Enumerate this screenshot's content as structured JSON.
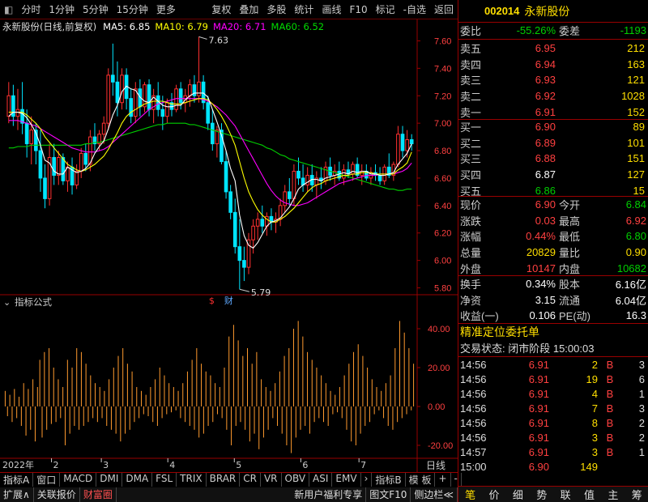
{
  "toolbar": {
    "left": [
      "分时",
      "1分钟",
      "5分钟",
      "15分钟",
      "更多"
    ],
    "right": [
      "复权",
      "叠加",
      "多股",
      "统计",
      "画线",
      "F10",
      "标记",
      "-自选",
      "返回"
    ]
  },
  "chart_title": {
    "name": "永新股份(日线,前复权)",
    "ma5": "MA5: 6.85",
    "ma10": "MA10: 6.79",
    "ma20": "MA20: 6.71",
    "ma60": "MA60: 6.52"
  },
  "colors": {
    "up": "#ff3030",
    "down": "#00e5ff",
    "ma5": "#ffffff",
    "ma10": "#ffff00",
    "ma20": "#ff00ff",
    "ma60": "#00d000",
    "macd": "#ff9a2e",
    "frame": "#990000"
  },
  "chart_data": [
    {
      "type": "candlestick",
      "ylim": [
        5.75,
        7.65
      ],
      "yticks": [
        "7.60",
        "7.40",
        "7.20",
        "7.00",
        "6.80",
        "6.60",
        "6.40",
        "6.20",
        "6.00",
        "5.80"
      ],
      "annotations": {
        "high": "7.63",
        "low": "5.79",
        "markers": [
          "$",
          "财"
        ]
      },
      "x_axis": {
        "year_label": "2022年",
        "months": [
          "2",
          "3",
          "4",
          "5",
          "6",
          "7"
        ]
      },
      "series_labels": [
        "MA5",
        "MA10",
        "MA20",
        "MA60"
      ],
      "ohlc": [
        [
          7.05,
          7.3,
          7.0,
          7.2
        ],
        [
          7.2,
          7.28,
          6.98,
          7.05
        ],
        [
          7.05,
          7.25,
          6.95,
          7.1
        ],
        [
          7.1,
          7.3,
          6.92,
          7.0
        ],
        [
          7.0,
          7.1,
          6.75,
          6.85
        ],
        [
          6.85,
          7.05,
          6.7,
          6.95
        ],
        [
          6.95,
          7.0,
          6.7,
          6.8
        ],
        [
          6.8,
          6.95,
          6.5,
          6.6
        ],
        [
          6.6,
          6.7,
          6.38,
          6.45
        ],
        [
          6.45,
          6.85,
          6.4,
          6.75
        ],
        [
          6.75,
          6.85,
          6.55,
          6.62
        ],
        [
          6.62,
          6.8,
          6.55,
          6.75
        ],
        [
          6.75,
          6.78,
          6.55,
          6.58
        ],
        [
          6.58,
          6.72,
          6.5,
          6.68
        ],
        [
          6.68,
          6.75,
          6.48,
          6.55
        ],
        [
          6.55,
          6.7,
          6.52,
          6.65
        ],
        [
          6.65,
          6.82,
          6.6,
          6.78
        ],
        [
          6.78,
          6.85,
          6.65,
          6.7
        ],
        [
          6.7,
          6.95,
          6.65,
          6.9
        ],
        [
          6.9,
          7.0,
          6.8,
          6.85
        ],
        [
          6.85,
          6.95,
          6.8,
          6.92
        ],
        [
          6.92,
          7.05,
          6.85,
          7.0
        ],
        [
          7.0,
          7.4,
          6.95,
          7.35
        ],
        [
          7.35,
          7.58,
          7.2,
          7.3
        ],
        [
          7.3,
          7.45,
          7.05,
          7.15
        ],
        [
          7.15,
          7.4,
          7.1,
          7.35
        ],
        [
          7.35,
          7.4,
          7.1,
          7.18
        ],
        [
          7.18,
          7.25,
          7.0,
          7.05
        ],
        [
          7.05,
          7.3,
          7.0,
          7.25
        ],
        [
          7.25,
          7.32,
          7.05,
          7.12
        ],
        [
          7.12,
          7.3,
          7.08,
          7.28
        ],
        [
          7.28,
          7.32,
          7.05,
          7.1
        ],
        [
          7.1,
          7.25,
          7.0,
          7.2
        ],
        [
          7.2,
          7.3,
          7.05,
          7.1
        ],
        [
          7.1,
          7.2,
          6.95,
          7.05
        ],
        [
          7.05,
          7.18,
          7.0,
          7.15
        ],
        [
          7.15,
          7.22,
          7.05,
          7.1
        ],
        [
          7.1,
          7.28,
          7.08,
          7.25
        ],
        [
          7.25,
          7.3,
          7.1,
          7.15
        ],
        [
          7.15,
          7.25,
          7.08,
          7.2
        ],
        [
          7.2,
          7.32,
          7.12,
          7.28
        ],
        [
          7.28,
          7.35,
          7.15,
          7.2
        ],
        [
          7.2,
          7.63,
          7.15,
          7.3
        ],
        [
          7.3,
          7.35,
          7.1,
          7.15
        ],
        [
          7.15,
          7.2,
          6.95,
          7.0
        ],
        [
          7.0,
          7.1,
          6.8,
          6.85
        ],
        [
          6.85,
          6.98,
          6.75,
          6.95
        ],
        [
          6.95,
          7.0,
          6.7,
          6.72
        ],
        [
          6.72,
          6.8,
          6.45,
          6.5
        ],
        [
          6.5,
          6.55,
          6.3,
          6.35
        ],
        [
          6.35,
          6.45,
          6.05,
          6.1
        ],
        [
          6.1,
          6.3,
          5.79,
          6.0
        ],
        [
          6.0,
          6.1,
          5.85,
          5.95
        ],
        [
          5.95,
          6.2,
          5.9,
          6.15
        ],
        [
          6.15,
          6.3,
          6.05,
          6.25
        ],
        [
          6.25,
          6.35,
          6.15,
          6.3
        ],
        [
          6.3,
          6.4,
          6.2,
          6.25
        ],
        [
          6.25,
          6.35,
          6.18,
          6.32
        ],
        [
          6.32,
          6.38,
          6.22,
          6.28
        ],
        [
          6.28,
          6.35,
          6.2,
          6.3
        ],
        [
          6.3,
          6.45,
          6.25,
          6.4
        ],
        [
          6.4,
          6.55,
          6.35,
          6.5
        ],
        [
          6.5,
          6.6,
          6.4,
          6.45
        ],
        [
          6.45,
          6.7,
          6.4,
          6.65
        ],
        [
          6.65,
          6.75,
          6.55,
          6.6
        ],
        [
          6.6,
          6.7,
          6.5,
          6.55
        ],
        [
          6.55,
          6.68,
          6.5,
          6.62
        ],
        [
          6.62,
          6.7,
          6.5,
          6.55
        ],
        [
          6.55,
          6.65,
          6.45,
          6.6
        ],
        [
          6.6,
          6.68,
          6.52,
          6.58
        ],
        [
          6.58,
          6.72,
          6.55,
          6.68
        ],
        [
          6.68,
          6.75,
          6.58,
          6.62
        ],
        [
          6.62,
          6.7,
          6.55,
          6.65
        ],
        [
          6.65,
          6.72,
          6.58,
          6.6
        ],
        [
          6.6,
          6.7,
          6.55,
          6.66
        ],
        [
          6.66,
          6.72,
          6.6,
          6.63
        ],
        [
          6.63,
          6.72,
          6.58,
          6.7
        ],
        [
          6.7,
          6.75,
          6.6,
          6.62
        ],
        [
          6.62,
          6.7,
          6.55,
          6.65
        ],
        [
          6.65,
          6.7,
          6.58,
          6.6
        ],
        [
          6.6,
          6.68,
          6.55,
          6.64
        ],
        [
          6.64,
          6.7,
          6.58,
          6.62
        ],
        [
          6.62,
          6.68,
          6.55,
          6.58
        ],
        [
          6.58,
          6.7,
          6.55,
          6.68
        ],
        [
          6.68,
          6.78,
          6.6,
          6.62
        ],
        [
          6.62,
          6.72,
          6.58,
          6.7
        ],
        [
          6.7,
          6.98,
          6.68,
          6.92
        ],
        [
          6.92,
          6.98,
          6.75,
          6.8
        ],
        [
          6.8,
          6.95,
          6.75,
          6.88
        ],
        [
          6.88,
          6.92,
          6.8,
          6.85
        ]
      ],
      "ma5": [
        7.05,
        7.08,
        7.08,
        7.07,
        7.04,
        6.99,
        6.93,
        6.84,
        6.73,
        6.71,
        6.65,
        6.63,
        6.63,
        6.68,
        6.66,
        6.64,
        6.65,
        6.67,
        6.71,
        6.78,
        6.83,
        6.87,
        6.96,
        7.06,
        7.13,
        7.23,
        7.27,
        7.25,
        7.24,
        7.19,
        7.16,
        7.15,
        7.19,
        7.16,
        7.13,
        7.12,
        7.12,
        7.13,
        7.13,
        7.17,
        7.2,
        7.22,
        7.22,
        7.22,
        7.19,
        7.1,
        7.01,
        6.91,
        6.8,
        6.67,
        6.58,
        6.33,
        6.18,
        6.11,
        6.09,
        6.13,
        6.19,
        6.25,
        6.28,
        6.29,
        6.31,
        6.35,
        6.39,
        6.45,
        6.52,
        6.55,
        6.57,
        6.59,
        6.59,
        6.58,
        6.6,
        6.61,
        6.62,
        6.63,
        6.64,
        6.63,
        6.65,
        6.64,
        6.65,
        6.65,
        6.63,
        6.63,
        6.62,
        6.62,
        6.63,
        6.64,
        6.7,
        6.74,
        6.78,
        6.85
      ],
      "ma10": [
        7.08,
        7.08,
        7.08,
        7.08,
        7.06,
        7.03,
        7.0,
        6.96,
        6.9,
        6.86,
        6.82,
        6.78,
        6.74,
        6.7,
        6.68,
        6.66,
        6.65,
        6.66,
        6.68,
        6.7,
        6.73,
        6.76,
        6.81,
        6.87,
        6.93,
        7.0,
        7.05,
        7.08,
        7.1,
        7.12,
        7.14,
        7.15,
        7.16,
        7.16,
        7.16,
        7.15,
        7.14,
        7.14,
        7.14,
        7.15,
        7.16,
        7.17,
        7.18,
        7.18,
        7.17,
        7.14,
        7.1,
        7.05,
        6.99,
        6.92,
        6.84,
        6.72,
        6.6,
        6.5,
        6.43,
        6.37,
        6.33,
        6.3,
        6.28,
        6.28,
        6.3,
        6.32,
        6.35,
        6.38,
        6.42,
        6.46,
        6.5,
        6.53,
        6.55,
        6.56,
        6.58,
        6.59,
        6.6,
        6.61,
        6.62,
        6.62,
        6.63,
        6.63,
        6.64,
        6.64,
        6.64,
        6.63,
        6.63,
        6.63,
        6.63,
        6.63,
        6.66,
        6.68,
        6.71,
        6.79
      ],
      "ma20": [
        7.02,
        7.02,
        7.02,
        7.01,
        7.0,
        6.99,
        6.98,
        6.96,
        6.94,
        6.92,
        6.9,
        6.88,
        6.86,
        6.84,
        6.82,
        6.81,
        6.8,
        6.79,
        6.79,
        6.79,
        6.8,
        6.81,
        6.83,
        6.86,
        6.89,
        6.92,
        6.95,
        6.98,
        7.01,
        7.04,
        7.07,
        7.1,
        7.12,
        7.14,
        7.15,
        7.16,
        7.17,
        7.18,
        7.18,
        7.18,
        7.18,
        7.18,
        7.18,
        7.17,
        7.16,
        7.14,
        7.12,
        7.09,
        7.06,
        7.02,
        6.98,
        6.92,
        6.86,
        6.8,
        6.74,
        6.68,
        6.62,
        6.56,
        6.51,
        6.47,
        6.44,
        6.42,
        6.41,
        6.4,
        6.4,
        6.41,
        6.42,
        6.44,
        6.46,
        6.48,
        6.5,
        6.52,
        6.54,
        6.56,
        6.57,
        6.58,
        6.59,
        6.6,
        6.61,
        6.62,
        6.62,
        6.62,
        6.63,
        6.63,
        6.63,
        6.63,
        6.64,
        6.65,
        6.67,
        6.71
      ],
      "ma60": [
        6.82,
        6.82,
        6.83,
        6.83,
        6.83,
        6.84,
        6.84,
        6.84,
        6.84,
        6.84,
        6.84,
        6.84,
        6.84,
        6.84,
        6.84,
        6.84,
        6.84,
        6.85,
        6.85,
        6.86,
        6.86,
        6.87,
        6.88,
        6.89,
        6.9,
        6.91,
        6.92,
        6.93,
        6.94,
        6.95,
        6.96,
        6.97,
        6.98,
        6.99,
        6.99,
        7.0,
        7.0,
        7.0,
        7.0,
        7.0,
        6.99,
        6.99,
        6.98,
        6.97,
        6.96,
        6.95,
        6.94,
        6.93,
        6.92,
        6.91,
        6.9,
        6.89,
        6.88,
        6.87,
        6.86,
        6.85,
        6.84,
        6.82,
        6.81,
        6.79,
        6.77,
        6.76,
        6.74,
        6.73,
        6.72,
        6.71,
        6.7,
        6.69,
        6.68,
        6.67,
        6.66,
        6.65,
        6.64,
        6.63,
        6.62,
        6.61,
        6.6,
        6.59,
        6.58,
        6.57,
        6.56,
        6.55,
        6.54,
        6.53,
        6.52,
        6.52,
        6.51,
        6.51,
        6.52,
        6.52
      ]
    },
    {
      "type": "bar",
      "title": "指标公式",
      "ylim": [
        -25,
        50
      ],
      "yticks": [
        "40.00",
        "20.00",
        "0.00",
        "-20.00"
      ],
      "values": [
        8,
        -5,
        6,
        -8,
        9,
        -6,
        5,
        -10,
        12,
        -15,
        9,
        -12,
        14,
        -18,
        10,
        24,
        -16,
        28,
        -12,
        30,
        -9,
        20,
        -8,
        14,
        -6,
        10,
        -20,
        24,
        -14,
        20,
        -10,
        30,
        -12,
        28,
        -10,
        22,
        -8,
        16,
        -6,
        12,
        -8,
        10,
        -6,
        8,
        -10,
        14,
        -12,
        20,
        -14,
        26,
        -18,
        30,
        -14,
        22,
        -12,
        18,
        -8,
        10,
        -6,
        8,
        -4,
        6,
        -5,
        10,
        -8,
        14,
        -10,
        20,
        -6,
        16,
        -4,
        12,
        -3,
        10,
        -2,
        8,
        -6,
        12,
        -8,
        18,
        -10,
        24,
        -12,
        30,
        -16,
        22,
        -14,
        18,
        -10,
        16,
        -8,
        12,
        -4,
        10,
        -6,
        20,
        -12,
        36,
        -20,
        42,
        -10,
        34,
        -8,
        26,
        -12,
        30,
        -18,
        22,
        -14,
        28,
        -22,
        14,
        -16,
        10,
        -12,
        8,
        -6,
        12,
        -10,
        18,
        -14,
        26,
        -20,
        30,
        -24,
        40,
        -16,
        44,
        -12,
        36,
        -10,
        28,
        -14,
        24,
        -8,
        20,
        -6,
        16,
        -8,
        12,
        -10,
        8,
        -4,
        6,
        -3,
        10,
        -6,
        16,
        -12,
        22,
        -18,
        28,
        -20,
        32,
        -14,
        26,
        -10,
        20,
        -8,
        14,
        -4,
        10,
        -2,
        8,
        -6,
        12,
        -10,
        16,
        -12,
        30,
        -8,
        44,
        -6,
        38,
        -4,
        30,
        -2,
        22
      ]
    }
  ],
  "bottom": {
    "day_label": "日线",
    "tabs": [
      "指标A",
      "窗口",
      "MACD",
      "DMI",
      "DMA",
      "FSL",
      "TRIX",
      "BRAR",
      "CR",
      "VR",
      "OBV",
      "ASI",
      "EMV",
      "›",
      "指标B",
      "模 板",
      "+",
      "-"
    ],
    "bar2": [
      "扩展∧",
      "关联报价",
      "财富圈",
      "新用户福利专享",
      "图文F10",
      "侧边栏≪"
    ]
  },
  "quote": {
    "code": "002014",
    "name": "永新股份",
    "weibi_label": "委比",
    "weibi": "-55.26%",
    "weicha_label": "委差",
    "weicha": "-1193",
    "asks": [
      [
        "卖五",
        "6.95",
        "212"
      ],
      [
        "卖四",
        "6.94",
        "163"
      ],
      [
        "卖三",
        "6.93",
        "121"
      ],
      [
        "卖二",
        "6.92",
        "1028"
      ],
      [
        "卖一",
        "6.91",
        "152"
      ]
    ],
    "bids": [
      [
        "买一",
        "6.90",
        "89"
      ],
      [
        "买二",
        "6.89",
        "101"
      ],
      [
        "买三",
        "6.88",
        "151"
      ],
      [
        "买四",
        "6.87",
        "127"
      ],
      [
        "买五",
        "6.86",
        "15"
      ]
    ],
    "stats": [
      [
        "现价",
        "6.90",
        "今开",
        "6.84"
      ],
      [
        "涨跌",
        "0.03",
        "最高",
        "6.92"
      ],
      [
        "涨幅",
        "0.44%",
        "最低",
        "6.80"
      ],
      [
        "总量",
        "20829",
        "量比",
        "0.90"
      ],
      [
        "外盘",
        "10147",
        "内盘",
        "10682"
      ]
    ],
    "fin": [
      [
        "换手",
        "0.34%",
        "股本",
        "6.16亿"
      ],
      [
        "净资",
        "3.15",
        "流通",
        "6.04亿"
      ],
      [
        "收益(一)",
        "0.106",
        "PE(动)",
        "16.3"
      ]
    ],
    "precise": "精准定位委托单",
    "status": "交易状态: 闭市阶段 15:00:03",
    "ticks": [
      [
        "14:56",
        "6.91",
        "2",
        "B",
        "3"
      ],
      [
        "14:56",
        "6.91",
        "19",
        "B",
        "6"
      ],
      [
        "14:56",
        "6.91",
        "4",
        "B",
        "1"
      ],
      [
        "14:56",
        "6.91",
        "7",
        "B",
        "3"
      ],
      [
        "14:56",
        "6.91",
        "8",
        "B",
        "2"
      ],
      [
        "14:56",
        "6.91",
        "3",
        "B",
        "2"
      ],
      [
        "14:57",
        "6.91",
        "3",
        "B",
        "1"
      ],
      [
        "15:00",
        "6.90",
        "149",
        "",
        ""
      ]
    ],
    "tabs": [
      "笔",
      "价",
      "细",
      "势",
      "联",
      "值",
      "主",
      "筹"
    ]
  }
}
